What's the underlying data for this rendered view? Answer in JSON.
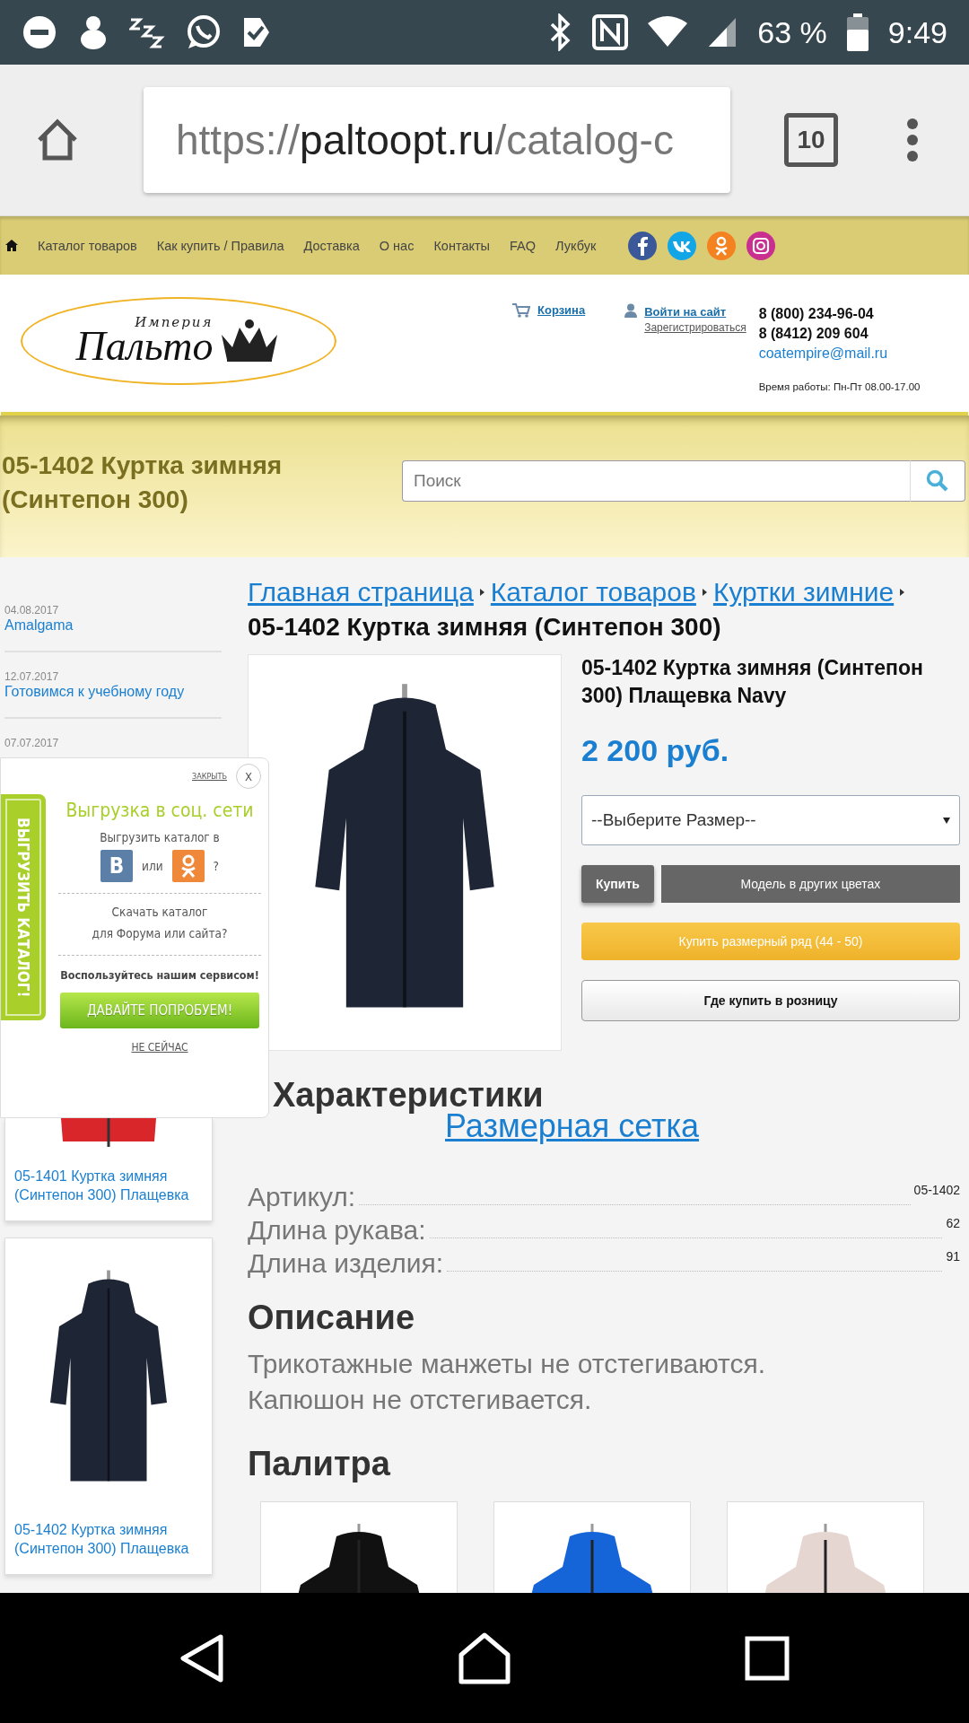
{
  "status_bar": {
    "battery": "63 %",
    "time": "9:49"
  },
  "browser": {
    "url_scheme": "https://",
    "url_host": "paltoopt.ru",
    "url_path": "/catalog-c",
    "tab_count": "10"
  },
  "site_nav": {
    "items": [
      "Каталог товаров",
      "Как купить / Правила",
      "Доставка",
      "О нас",
      "Контакты",
      "FAQ",
      "Лукбук"
    ]
  },
  "header": {
    "logo_small": "Империя",
    "logo_big": "Пальто",
    "cart": "Корзина",
    "login": "Войти на сайт",
    "register": "Зарегистрироваться",
    "phones": [
      "8 (800) 234-96-04",
      "8 (8412) 209 604"
    ],
    "email": "coatempire@mail.ru",
    "hours": "Время работы: Пн-Пт 08.00-17.00"
  },
  "page_title": "05-1402 Куртка зимняя (Синтепон 300)",
  "search": {
    "placeholder": "Поиск"
  },
  "news": [
    {
      "date": "04.08.2017",
      "title": "Amalgama"
    },
    {
      "date": "12.07.2017",
      "title": "Готовимся к учебному году"
    },
    {
      "date": "07.07.2017"
    }
  ],
  "viewed": {
    "items": [
      {
        "title": "05-1401 Куртка зимняя (Синтепон 300) Плащевка",
        "color": "#d8262a"
      },
      {
        "title": "05-1402 Куртка зимняя (Синтепон 300) Плащевка",
        "color": "#1e2535"
      }
    ]
  },
  "breadcrumbs": [
    "Главная страница",
    "Каталог товаров",
    "Куртки зимние"
  ],
  "heading": "05-1402 Куртка зимняя (Синтепон 300)",
  "product": {
    "name": "05-1402 Куртка зимняя (Синтепон 300) Плащевка Navy",
    "color": "#1e2535",
    "price": "2 200 руб.",
    "size_select": "--Выберите Размер--",
    "buy": "Купить",
    "other_colors": "Модель в других цветах",
    "buy_range": "Купить размерный ряд (44 - 50)",
    "retail": "Где купить в розницу"
  },
  "characteristics": {
    "heading": "Характеристики",
    "size_chart_link": "Размерная сетка",
    "rows": [
      {
        "label": "Артикул:",
        "value": "05-1402"
      },
      {
        "label": "Длина рукава:",
        "value": "62"
      },
      {
        "label": "Длина изделия:",
        "value": "91"
      }
    ]
  },
  "description": {
    "heading": "Описание",
    "lines": [
      "Трикотажные манжеты не отстегиваются.",
      "Капюшон не отстегивается."
    ]
  },
  "palette": {
    "heading": "Палитра",
    "items": [
      {
        "color": "#111111"
      },
      {
        "color": "#1565d8"
      },
      {
        "color": "#e6d6d2"
      }
    ]
  },
  "popup": {
    "close_text": "ЗАКРЫТЬ",
    "close_x": "X",
    "side_tab": "ВЫГРУЗИТЬ КАТАЛОГ!",
    "title": "Выгрузка в соц. сети",
    "export_text": "Выгрузить каталог в",
    "vk_label": "В",
    "or_text": "или",
    "question": "?",
    "download_lines": [
      "Скачать каталог",
      "для Форума или сайта?"
    ],
    "service_text": "Воспользуйтесь нашим сервисом!",
    "try_button": "ДАВАЙТЕ ПОПРОБУЕМ!",
    "not_now": "НЕ СЕЙЧАС"
  }
}
